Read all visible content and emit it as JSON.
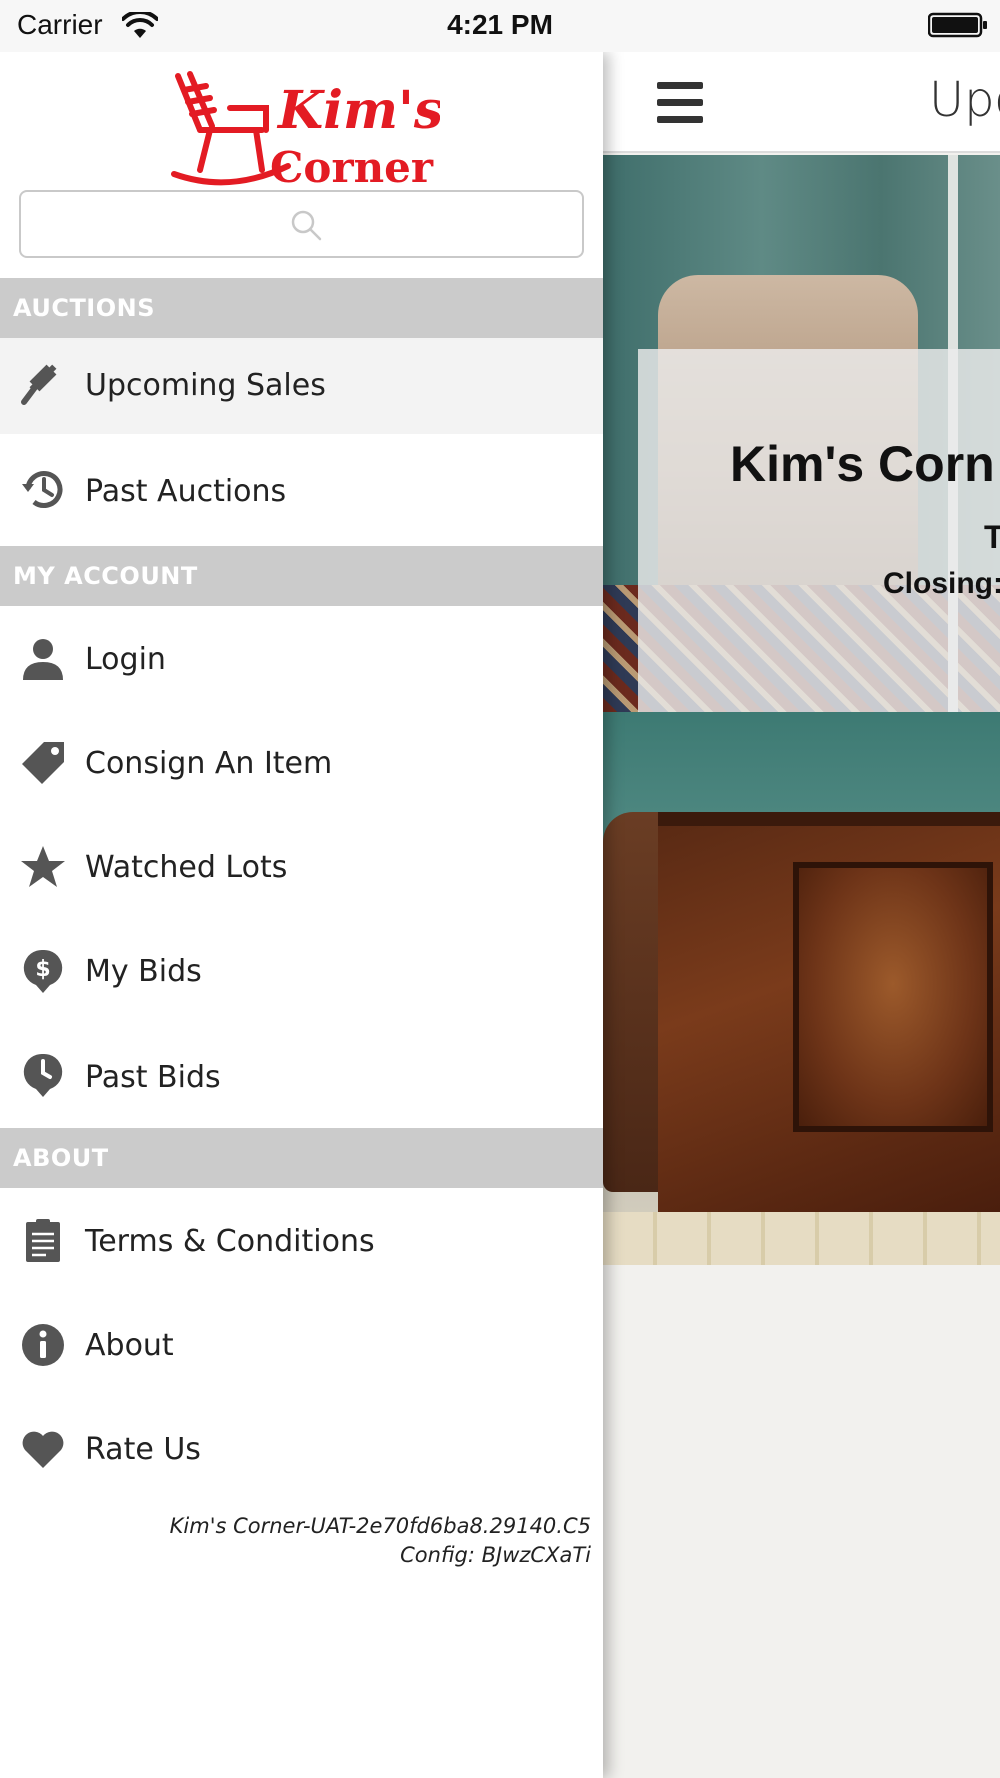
{
  "status_bar": {
    "carrier": "Carrier",
    "time": "4:21 PM",
    "wifi_icon": "wifi-icon",
    "battery_icon": "battery-icon"
  },
  "brand": {
    "logo_text_line1": "Kim's",
    "logo_text_line2": "Corner",
    "logo_color": "#e31b23",
    "logo_icon": "rocking-chair-icon"
  },
  "search": {
    "placeholder": "",
    "value": "",
    "icon": "search-icon"
  },
  "menu": {
    "sections": [
      {
        "title": "AUCTIONS",
        "items": [
          {
            "label": "Upcoming Sales",
            "icon": "gavel-icon",
            "active": true
          },
          {
            "label": "Past Auctions",
            "icon": "history-icon",
            "active": false
          }
        ]
      },
      {
        "title": "MY ACCOUNT",
        "items": [
          {
            "label": "Login",
            "icon": "user-icon"
          },
          {
            "label": "Consign An Item",
            "icon": "tag-icon"
          },
          {
            "label": "Watched Lots",
            "icon": "star-icon"
          },
          {
            "label": "My Bids",
            "icon": "dollar-bubble-icon"
          },
          {
            "label": "Past Bids",
            "icon": "clock-bubble-icon"
          }
        ]
      },
      {
        "title": "ABOUT",
        "items": [
          {
            "label": "Terms & Conditions",
            "icon": "clipboard-icon"
          },
          {
            "label": "About",
            "icon": "info-icon"
          },
          {
            "label": "Rate Us",
            "icon": "heart-icon"
          }
        ]
      }
    ]
  },
  "footer": {
    "version": "Kim's Corner-UAT-2e70fd6ba8.29140.C5",
    "config": "Config: BJwzCXaTi"
  },
  "main": {
    "page_title": "Upc",
    "menu_icon": "hamburger-icon",
    "card": {
      "title": "Kim's Corn",
      "line1": "T",
      "closing_label": "Closing:"
    }
  },
  "colors": {
    "section_header_bg": "#cbcbcb",
    "active_item_bg": "#f3f3f3",
    "icon_color": "#555555"
  }
}
